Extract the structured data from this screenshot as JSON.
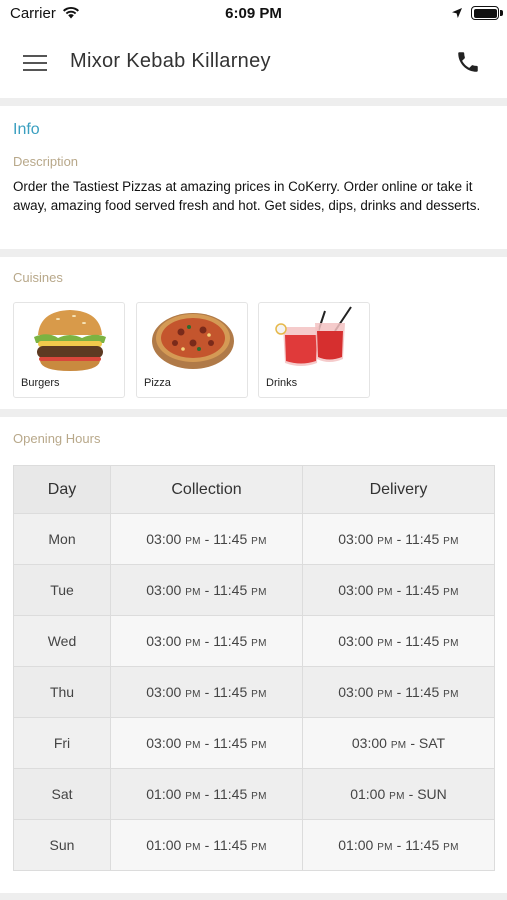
{
  "status_bar": {
    "carrier": "Carrier",
    "time": "6:09 PM"
  },
  "header": {
    "title": "Mixor Kebab Killarney"
  },
  "info": {
    "title": "Info",
    "description_label": "Description",
    "description": "Order the Tastiest Pizzas at amazing prices in CoKerry. Order online or take it away, amazing food served fresh and hot. Get sides, dips, drinks and desserts."
  },
  "cuisines": {
    "label": "Cuisines",
    "items": [
      {
        "name": "Burgers",
        "icon": "burger-icon"
      },
      {
        "name": "Pizza",
        "icon": "pizza-icon"
      },
      {
        "name": "Drinks",
        "icon": "drinks-icon"
      }
    ]
  },
  "opening_hours": {
    "label": "Opening Hours",
    "columns": [
      "Day",
      "Collection",
      "Delivery"
    ],
    "rows": [
      {
        "day": "Mon",
        "collection": {
          "from": "03:00",
          "from_ampm": "PM",
          "to": "11:45",
          "to_ampm": "PM"
        },
        "delivery": {
          "from": "03:00",
          "from_ampm": "PM",
          "to": "11:45",
          "to_ampm": "PM"
        }
      },
      {
        "day": "Tue",
        "collection": {
          "from": "03:00",
          "from_ampm": "PM",
          "to": "11:45",
          "to_ampm": "PM"
        },
        "delivery": {
          "from": "03:00",
          "from_ampm": "PM",
          "to": "11:45",
          "to_ampm": "PM"
        }
      },
      {
        "day": "Wed",
        "collection": {
          "from": "03:00",
          "from_ampm": "PM",
          "to": "11:45",
          "to_ampm": "PM"
        },
        "delivery": {
          "from": "03:00",
          "from_ampm": "PM",
          "to": "11:45",
          "to_ampm": "PM"
        }
      },
      {
        "day": "Thu",
        "collection": {
          "from": "03:00",
          "from_ampm": "PM",
          "to": "11:45",
          "to_ampm": "PM"
        },
        "delivery": {
          "from": "03:00",
          "from_ampm": "PM",
          "to": "11:45",
          "to_ampm": "PM"
        }
      },
      {
        "day": "Fri",
        "collection": {
          "from": "03:00",
          "from_ampm": "PM",
          "to": "11:45",
          "to_ampm": "PM"
        },
        "delivery": {
          "from": "03:00",
          "from_ampm": "PM",
          "to": "SAT",
          "to_ampm": ""
        }
      },
      {
        "day": "Sat",
        "collection": {
          "from": "01:00",
          "from_ampm": "PM",
          "to": "11:45",
          "to_ampm": "PM"
        },
        "delivery": {
          "from": "01:00",
          "from_ampm": "PM",
          "to": "SUN",
          "to_ampm": ""
        }
      },
      {
        "day": "Sun",
        "collection": {
          "from": "01:00",
          "from_ampm": "PM",
          "to": "11:45",
          "to_ampm": "PM"
        },
        "delivery": {
          "from": "01:00",
          "from_ampm": "PM",
          "to": "11:45",
          "to_ampm": "PM"
        }
      }
    ]
  },
  "colors": {
    "accent": "#3a9fc0",
    "section_label": "#b8a88a",
    "divider": "#eeeeee"
  }
}
